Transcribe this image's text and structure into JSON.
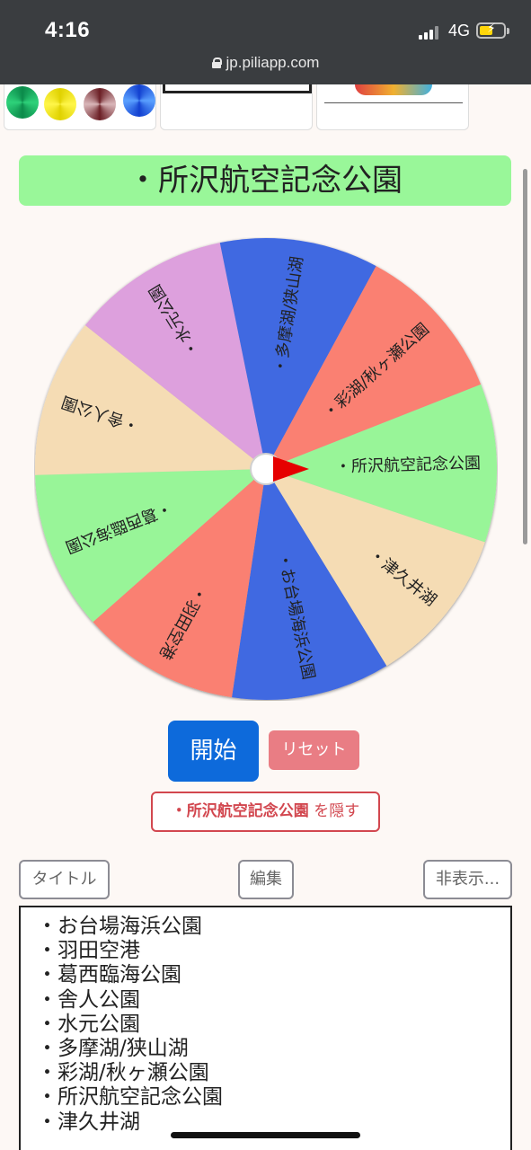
{
  "status_bar": {
    "time": "4:16",
    "network": "4G",
    "url": "jp.piliapp.com"
  },
  "result_title": "・所沢航空記念公園",
  "wheel": {
    "pointer_color": "#e60000",
    "segments": [
      {
        "label": "・所沢航空記念公園",
        "color": "#98f598"
      },
      {
        "label": "・津久井湖",
        "color": "#f5dcb4"
      },
      {
        "label": "・お台場海浜公園",
        "color": "#4169e1"
      },
      {
        "label": "・羽田空港",
        "color": "#fa8072"
      },
      {
        "label": "・葛西臨海公園",
        "color": "#98f598"
      },
      {
        "label": "・舎人公園",
        "color": "#f5dcb4"
      },
      {
        "label": "・水元公園",
        "color": "#dda0dd"
      },
      {
        "label": "・多摩湖/狭山湖",
        "color": "#4169e1"
      },
      {
        "label": "・彩湖/秋ヶ瀬公園",
        "color": "#fa8072"
      }
    ]
  },
  "buttons": {
    "start": "開始",
    "reset": "リセット",
    "hide_item": "・所沢航空記念公園",
    "hide_suffix": " を隠す",
    "title": "タイトル",
    "edit": "編集",
    "hide_menu": "非表示..."
  },
  "list_items": [
    "・お台場海浜公園",
    "・羽田空港",
    "・葛西臨海公園",
    "・舎人公園",
    "・水元公園",
    "・多摩湖/狭山湖",
    "・彩湖/秋ヶ瀬公園",
    "・所沢航空記念公園",
    "・津久井湖"
  ]
}
